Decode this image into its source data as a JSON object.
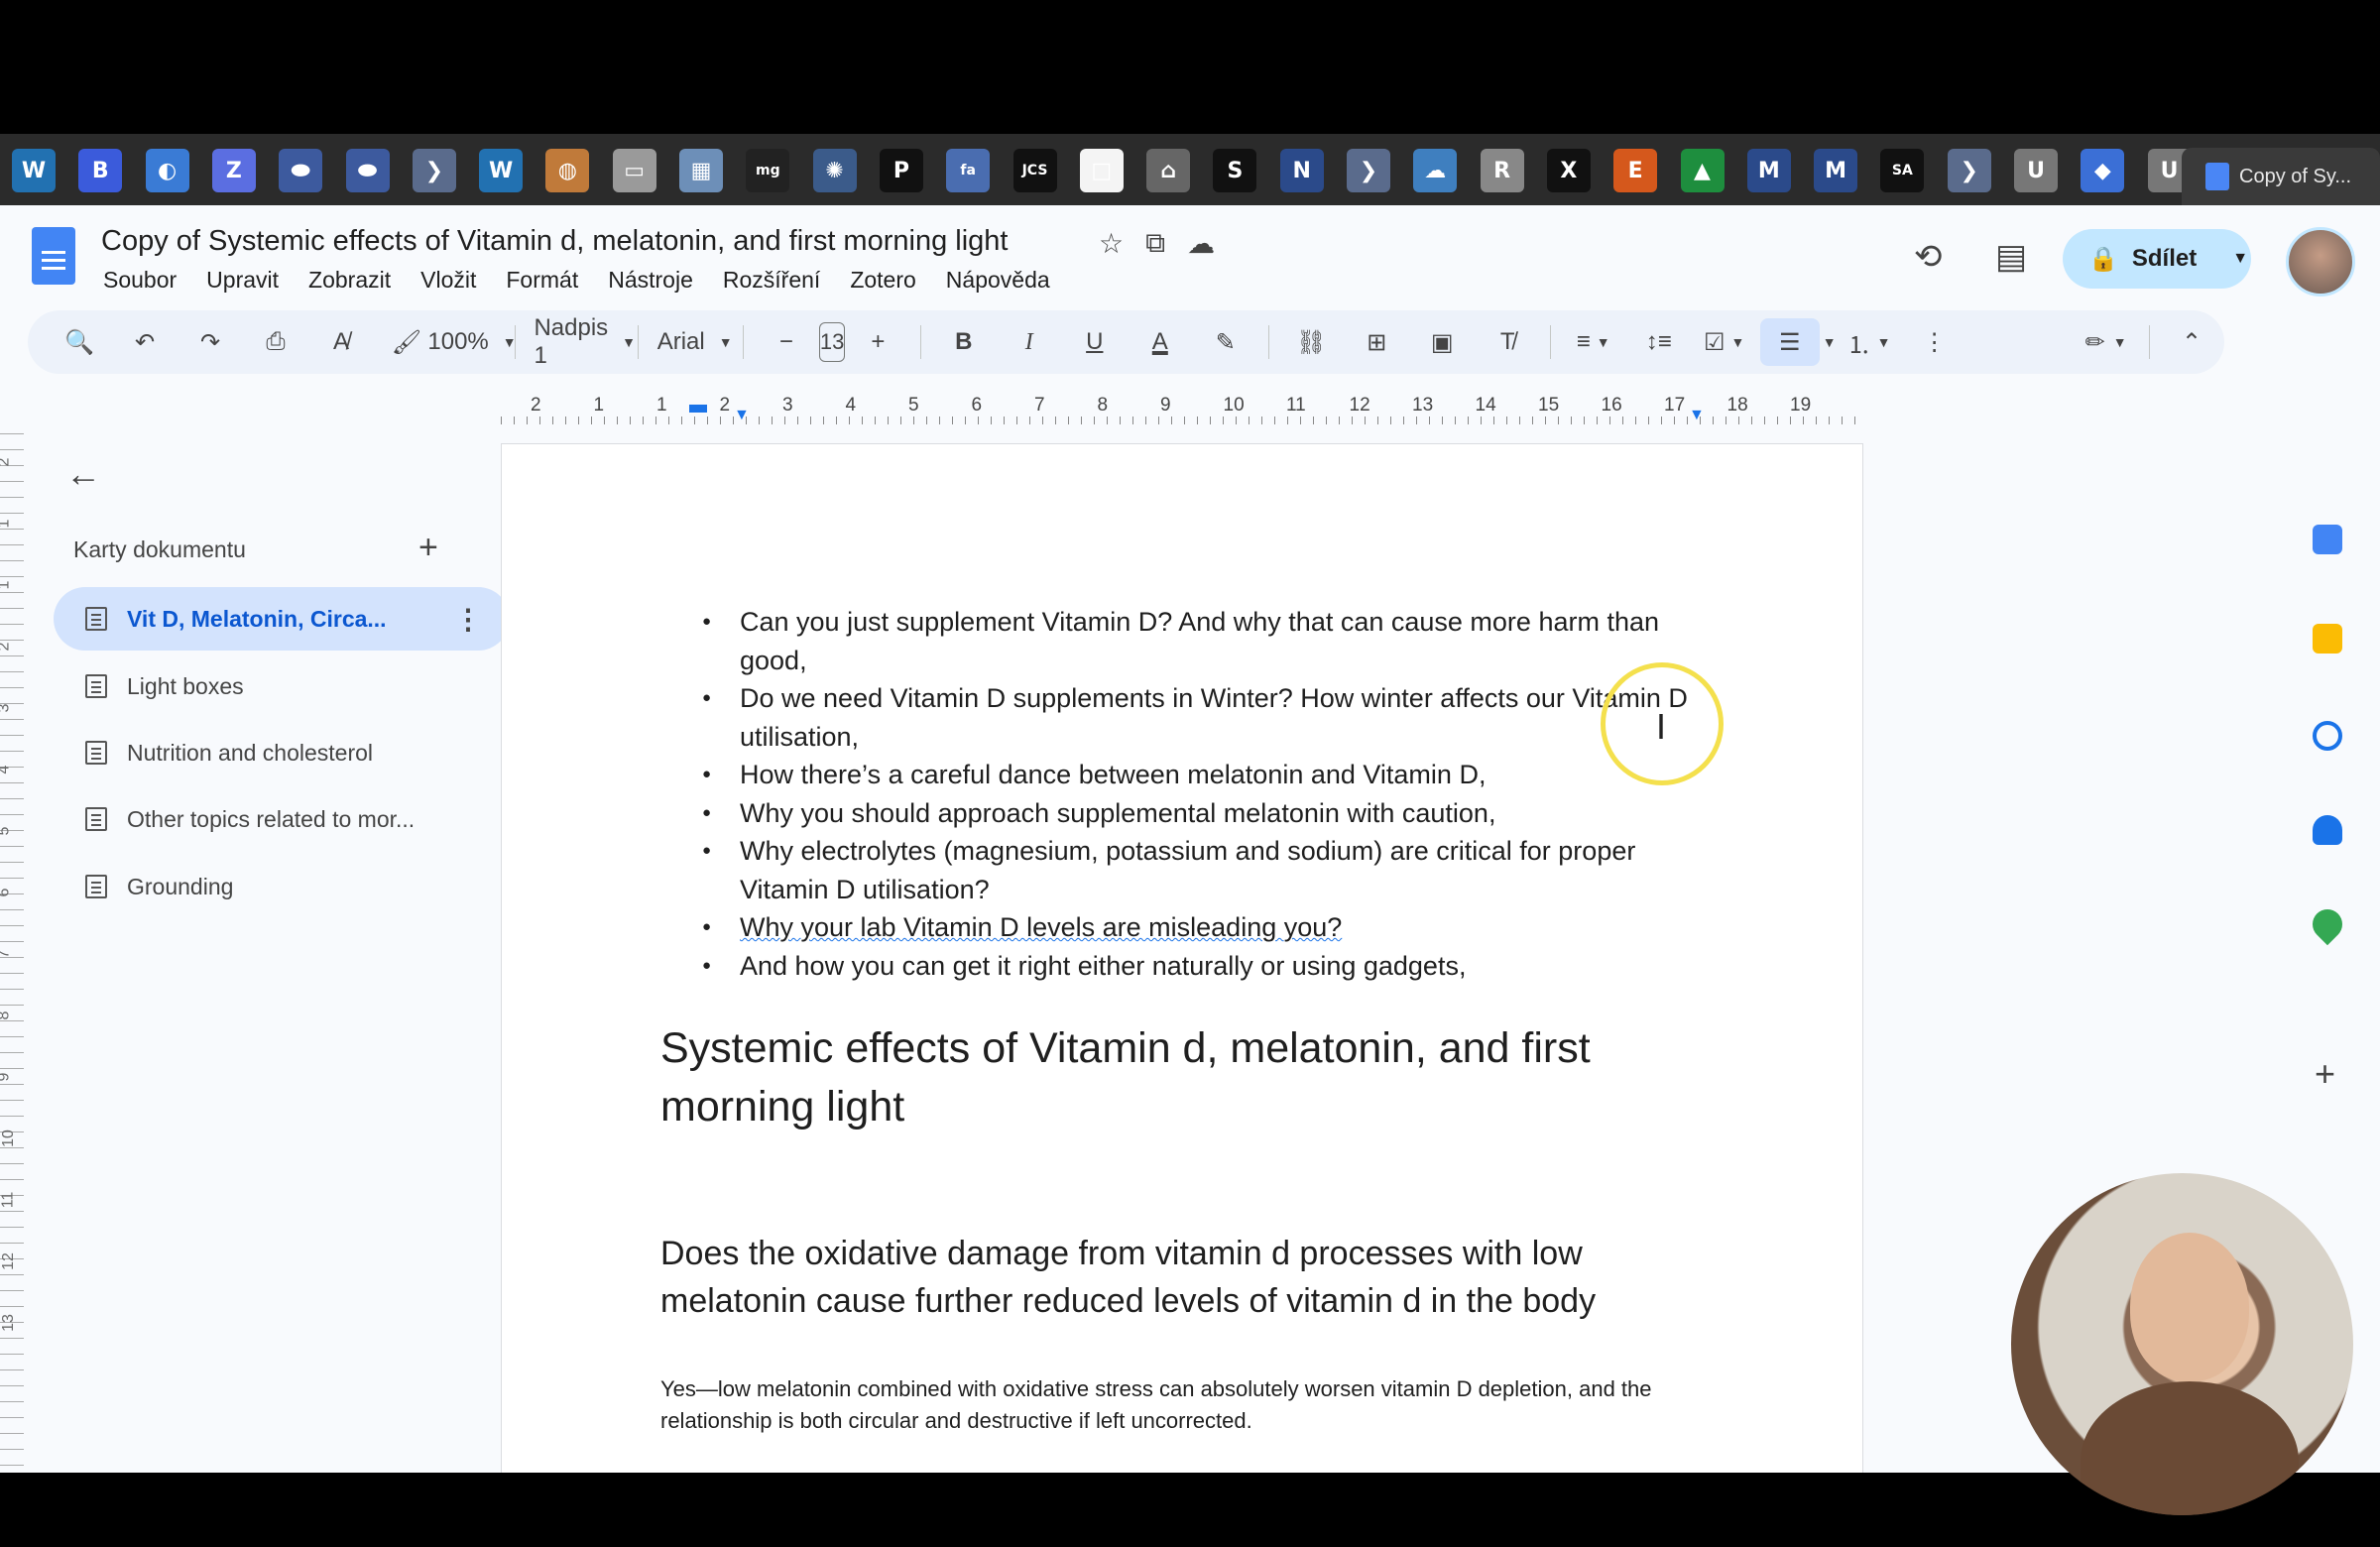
{
  "browser": {
    "tab_icons": [
      {
        "name": "wordpress-icon",
        "glyph": "W",
        "color": "#2271b1"
      },
      {
        "name": "b-app-icon",
        "glyph": "B",
        "color": "#3b5bdb"
      },
      {
        "name": "drop-icon",
        "glyph": "◐",
        "color": "#3a7bd5"
      },
      {
        "name": "z-app-icon",
        "glyph": "Z",
        "color": "#5b6ee1"
      },
      {
        "name": "pill-blue-icon",
        "glyph": "⬬",
        "color": "#3d5a9e"
      },
      {
        "name": "pill-blue-icon-2",
        "glyph": "⬬",
        "color": "#3d5a9e"
      },
      {
        "name": "chevron-app-icon",
        "glyph": "❯",
        "color": "#5a6b8c"
      },
      {
        "name": "wordpress-icon-2",
        "glyph": "W",
        "color": "#2271b1"
      },
      {
        "name": "coin-icon",
        "glyph": "◍",
        "color": "#c07a3a"
      },
      {
        "name": "blank-app-icon",
        "glyph": "▭",
        "color": "#9a9a9a"
      },
      {
        "name": "map-app-icon",
        "glyph": "▦",
        "color": "#6d8fb8"
      },
      {
        "name": "mg-icon",
        "glyph": "mg",
        "color": "#222"
      },
      {
        "name": "globe-icon",
        "glyph": "✺",
        "color": "#3b5b8a"
      },
      {
        "name": "p-app-icon",
        "glyph": "P",
        "color": "#111"
      },
      {
        "name": "fa-icon",
        "glyph": "fa",
        "color": "#4a6db0"
      },
      {
        "name": "jcs-icon",
        "glyph": "JCS",
        "color": "#111"
      },
      {
        "name": "white-square-icon",
        "glyph": "□",
        "color": "#f4f4f4"
      },
      {
        "name": "home-app-icon",
        "glyph": "⌂",
        "color": "#666"
      },
      {
        "name": "s-app-icon",
        "glyph": "S",
        "color": "#111"
      },
      {
        "name": "n-app-icon",
        "glyph": "N",
        "color": "#2b4a8a"
      },
      {
        "name": "chevron-app-icon-2",
        "glyph": "❯",
        "color": "#5a6b8c"
      },
      {
        "name": "cloud-app-icon",
        "glyph": "☁",
        "color": "#3f7fbf"
      },
      {
        "name": "research-icon",
        "glyph": "R",
        "color": "#888"
      },
      {
        "name": "x-icon",
        "glyph": "X",
        "color": "#111"
      },
      {
        "name": "etsy-icon",
        "glyph": "E",
        "color": "#d5581c"
      },
      {
        "name": "drive-icon",
        "glyph": "▲",
        "color": "#1e8e3e"
      },
      {
        "name": "m-app-icon",
        "glyph": "M",
        "color": "#2b4a8a"
      },
      {
        "name": "m-app-icon-2",
        "glyph": "M",
        "color": "#2b4a8a"
      },
      {
        "name": "sci-am-icon",
        "glyph": "SA",
        "color": "#111"
      },
      {
        "name": "chevron-app-icon-3",
        "glyph": "❯",
        "color": "#5a6b8c"
      },
      {
        "name": "u-app-icon",
        "glyph": "U",
        "color": "#777"
      },
      {
        "name": "diamond-app-icon",
        "glyph": "◆",
        "color": "#3b6fd6"
      },
      {
        "name": "u-app-icon-2",
        "glyph": "U",
        "color": "#777"
      }
    ],
    "active_tab_label": "Copy of Sy..."
  },
  "doc": {
    "title": "Copy of Systemic effects of Vitamin d, melatonin, and first morning light",
    "menu": [
      "Soubor",
      "Upravit",
      "Zobrazit",
      "Vložit",
      "Formát",
      "Nástroje",
      "Rozšíření",
      "Zotero",
      "Nápověda"
    ],
    "share_label": "Sdílet"
  },
  "toolbar": {
    "zoom": "100%",
    "style": "Nadpis 1",
    "font": "Arial",
    "size": "13"
  },
  "ruler_numbers": [
    "2",
    "1",
    "1",
    "2",
    "3",
    "4",
    "5",
    "6",
    "7",
    "8",
    "9",
    "10",
    "11",
    "12",
    "13",
    "14",
    "15",
    "16",
    "17",
    "18",
    "19"
  ],
  "vruler_numbers": [
    "2",
    "1",
    "1",
    "2",
    "3",
    "4",
    "5",
    "6",
    "7",
    "8",
    "9",
    "10",
    "11",
    "12",
    "13"
  ],
  "sidebar": {
    "header": "Karty dokumentu",
    "items": [
      {
        "label": "Vit D, Melatonin, Circa..."
      },
      {
        "label": "Light boxes"
      },
      {
        "label": "Nutrition and cholesterol"
      },
      {
        "label": "Other topics related to mor..."
      },
      {
        "label": "Grounding"
      }
    ]
  },
  "content": {
    "bullets": [
      "Can you just supplement Vitamin D? And why that can cause more harm than good,",
      "Do we need Vitamin D supplements in Winter? How winter affects our Vitamin D utilisation,",
      "How there’s a careful dance between melatonin and Vitamin D,",
      "Why you should approach supplemental melatonin with caution,",
      "Why electrolytes (magnesium, potassium and sodium) are critical for proper Vitamin D utilisation?",
      "Why your lab Vitamin D levels are misleading you?",
      "And how you can get it right either naturally or using gadgets,"
    ],
    "heading1": "Systemic effects of Vitamin d, melatonin, and first morning light",
    "heading2": "Does the oxidative damage from vitamin d processes with low melatonin cause further reduced levels of vitamin d in the body",
    "paragraph": "Yes—low melatonin combined with oxidative stress can absolutely worsen vitamin D depletion, and the relationship is both circular and destructive if left uncorrected."
  }
}
